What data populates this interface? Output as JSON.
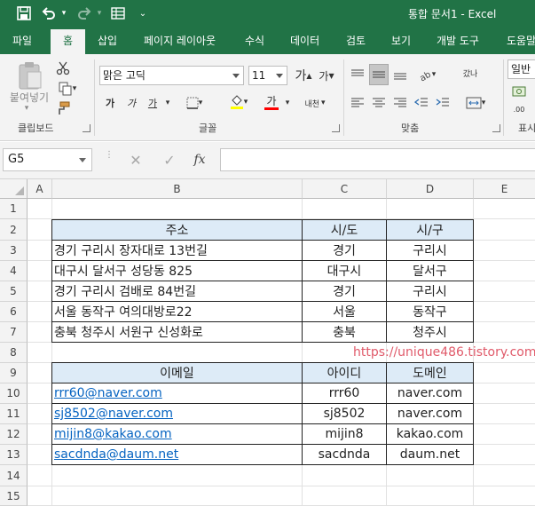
{
  "window": {
    "title": "통합 문서1  -  Excel"
  },
  "quick_access": {
    "save": "save-icon",
    "undo": "undo-icon",
    "redo": "redo-icon",
    "form": "form-icon",
    "customize": "customize-icon"
  },
  "tabs": [
    "파일",
    "홈",
    "삽입",
    "페이지 레이아웃",
    "수식",
    "데이터",
    "검토",
    "보기",
    "개발 도구",
    "도움말"
  ],
  "ribbon": {
    "clipboard": {
      "label": "클립보드",
      "paste": "붙여넣기"
    },
    "font": {
      "label": "글꼴",
      "name": "맑은 고딕",
      "size": "11",
      "grow": "가",
      "shrink": "가",
      "bold": "가",
      "italic": "가",
      "underline": "가",
      "font_color": "가",
      "phonetic": "내천"
    },
    "alignment": {
      "label": "맞춤",
      "wrap": "갔나"
    },
    "number": {
      "label": "표시",
      "format": "일반"
    }
  },
  "formula_bar": {
    "name_box": "G5",
    "fx": "fx",
    "formula": ""
  },
  "columns": [
    "A",
    "B",
    "C",
    "D",
    "E"
  ],
  "rows": [
    "1",
    "2",
    "3",
    "4",
    "5",
    "6",
    "7",
    "8",
    "9",
    "10",
    "11",
    "12",
    "13",
    "14",
    "15"
  ],
  "table1": {
    "headers": [
      "주소",
      "시/도",
      "시/구"
    ],
    "rows": [
      [
        "경기 구리시 장자대로 13번길",
        "경기",
        "구리시"
      ],
      [
        "대구시 달서구 성당동 825",
        "대구시",
        "달서구"
      ],
      [
        "경기 구리시 검배로 84번길",
        "경기",
        "구리시"
      ],
      [
        "서울 동작구 여의대방로22",
        "서울",
        "동작구"
      ],
      [
        "충북 청주시 서원구 신성화로",
        "충북",
        "청주시"
      ]
    ]
  },
  "watermark": "https://unique486.tistory.com",
  "table2": {
    "headers": [
      "이메일",
      "아이디",
      "도메인"
    ],
    "rows": [
      [
        "rrr60@naver.com",
        "rrr60",
        "naver.com"
      ],
      [
        "sj8502@naver.com",
        "sj8502",
        "naver.com"
      ],
      [
        "mijin8@kakao.com",
        "mijin8",
        "kakao.com"
      ],
      [
        "sacdnda@daum.net",
        "sacdnda",
        "daum.net"
      ]
    ]
  },
  "colors": {
    "excel_green": "#217346",
    "header_fill": "#ddebf7",
    "hyperlink": "#0563c1",
    "watermark": "#e05a6a"
  }
}
